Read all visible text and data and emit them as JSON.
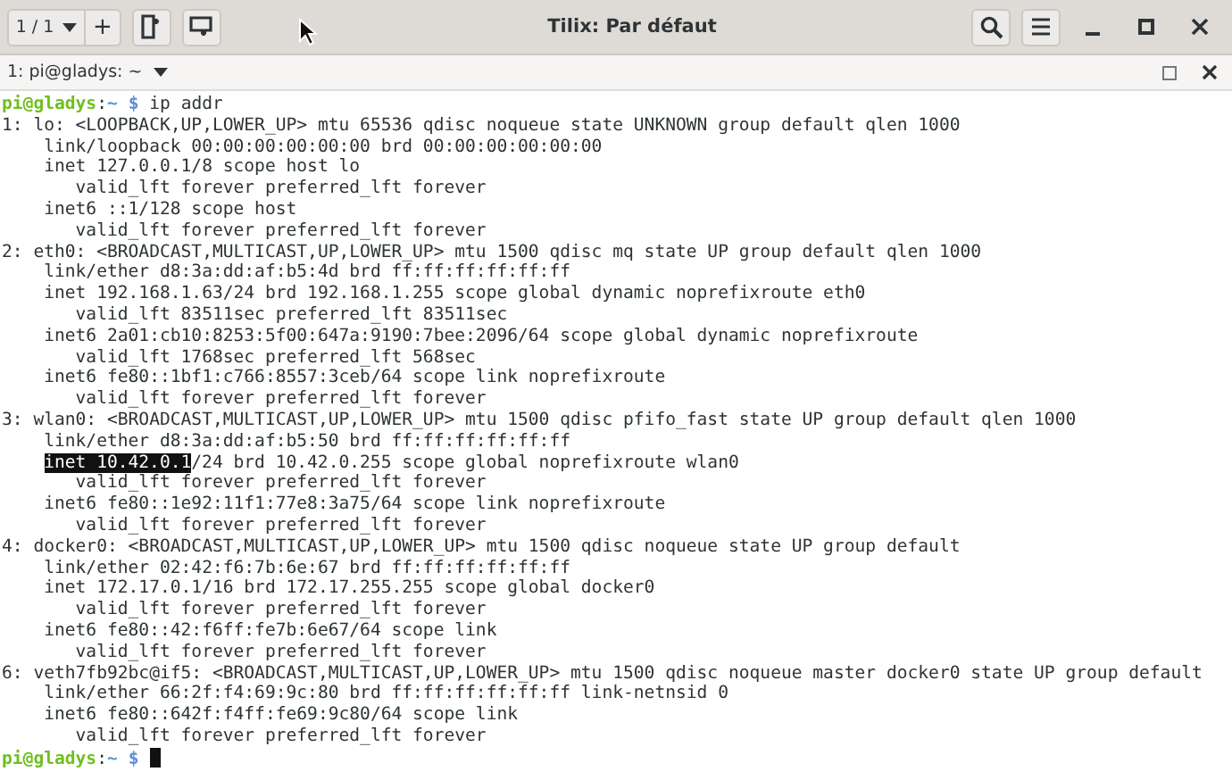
{
  "window": {
    "title": "Tilix: Par défaut"
  },
  "header": {
    "session_switcher": "1 / 1",
    "add_button": "+"
  },
  "terminal_tab": {
    "label": "1: pi@gladys: ~"
  },
  "terminal": {
    "lines": [
      {
        "kind": "prompt",
        "user_host": "pi@gladys",
        "separator": ":",
        "path": "~",
        "symbol": "$",
        "command": "ip addr"
      },
      {
        "kind": "output",
        "text": "1: lo: <LOOPBACK,UP,LOWER_UP> mtu 65536 qdisc noqueue state UNKNOWN group default qlen 1000"
      },
      {
        "kind": "output",
        "text": "    link/loopback 00:00:00:00:00:00 brd 00:00:00:00:00:00"
      },
      {
        "kind": "output",
        "text": "    inet 127.0.0.1/8 scope host lo"
      },
      {
        "kind": "output",
        "text": "       valid_lft forever preferred_lft forever"
      },
      {
        "kind": "output",
        "text": "    inet6 ::1/128 scope host"
      },
      {
        "kind": "output",
        "text": "       valid_lft forever preferred_lft forever"
      },
      {
        "kind": "output",
        "text": "2: eth0: <BROADCAST,MULTICAST,UP,LOWER_UP> mtu 1500 qdisc mq state UP group default qlen 1000"
      },
      {
        "kind": "output",
        "text": "    link/ether d8:3a:dd:af:b5:4d brd ff:ff:ff:ff:ff:ff"
      },
      {
        "kind": "output",
        "text": "    inet 192.168.1.63/24 brd 192.168.1.255 scope global dynamic noprefixroute eth0"
      },
      {
        "kind": "output",
        "text": "       valid_lft 83511sec preferred_lft 83511sec"
      },
      {
        "kind": "output",
        "text": "    inet6 2a01:cb10:8253:5f00:647a:9190:7bee:2096/64 scope global dynamic noprefixroute"
      },
      {
        "kind": "output",
        "text": "       valid_lft 1768sec preferred_lft 568sec"
      },
      {
        "kind": "output",
        "text": "    inet6 fe80::1bf1:c766:8557:3ceb/64 scope link noprefixroute"
      },
      {
        "kind": "output",
        "text": "       valid_lft forever preferred_lft forever"
      },
      {
        "kind": "output",
        "text": "3: wlan0: <BROADCAST,MULTICAST,UP,LOWER_UP> mtu 1500 qdisc pfifo_fast state UP group default qlen 1000"
      },
      {
        "kind": "output",
        "text": "    link/ether d8:3a:dd:af:b5:50 brd ff:ff:ff:ff:ff:ff"
      },
      {
        "kind": "selection",
        "selected_text": "inet 10.42.0.1",
        "text": "/24 brd 10.42.0.255 scope global noprefixroute wlan0"
      },
      {
        "kind": "output",
        "text": "       valid_lft forever preferred_lft forever"
      },
      {
        "kind": "output",
        "text": "    inet6 fe80::1e92:11f1:77e8:3a75/64 scope link noprefixroute"
      },
      {
        "kind": "output",
        "text": "       valid_lft forever preferred_lft forever"
      },
      {
        "kind": "output",
        "text": "4: docker0: <BROADCAST,MULTICAST,UP,LOWER_UP> mtu 1500 qdisc noqueue state UP group default"
      },
      {
        "kind": "output",
        "text": "    link/ether 02:42:f6:7b:6e:67 brd ff:ff:ff:ff:ff:ff"
      },
      {
        "kind": "output",
        "text": "    inet 172.17.0.1/16 brd 172.17.255.255 scope global docker0"
      },
      {
        "kind": "output",
        "text": "       valid_lft forever preferred_lft forever"
      },
      {
        "kind": "output",
        "text": "    inet6 fe80::42:f6ff:fe7b:6e67/64 scope link"
      },
      {
        "kind": "output",
        "text": "       valid_lft forever preferred_lft forever"
      },
      {
        "kind": "output",
        "text": "6: veth7fb92bc@if5: <BROADCAST,MULTICAST,UP,LOWER_UP> mtu 1500 qdisc noqueue master docker0 state UP group default"
      },
      {
        "kind": "output",
        "text": "    link/ether 66:2f:f4:69:9c:80 brd ff:ff:ff:ff:ff:ff link-netnsid 0"
      },
      {
        "kind": "output",
        "text": "    inet6 fe80::642f:f4ff:fe69:9c80/64 scope link"
      },
      {
        "kind": "output",
        "text": "       valid_lft forever preferred_lft forever"
      },
      {
        "kind": "prompt",
        "user_host": "pi@gladys",
        "separator": ":",
        "path": "~",
        "symbol": "$",
        "cursor": true
      }
    ]
  }
}
